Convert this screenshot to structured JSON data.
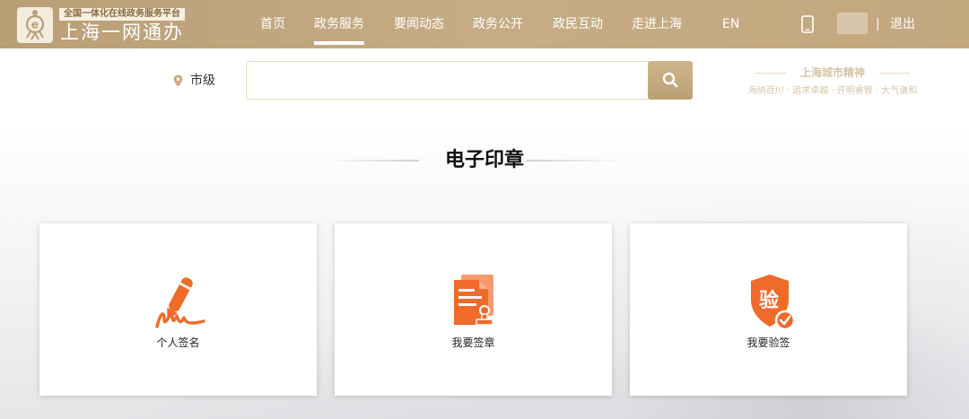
{
  "header": {
    "logo_badge": "全国一体化在线政务服务平台",
    "logo_title": "上海一网通办",
    "nav": [
      "首页",
      "政务服务",
      "要闻动态",
      "政务公开",
      "政民互动",
      "走进上海",
      "EN"
    ],
    "active_nav": "政务服务",
    "logout": "退出",
    "user_divider": "|"
  },
  "search": {
    "region": "市级",
    "placeholder": "",
    "value": ""
  },
  "spirit": {
    "title": "上海城市精神",
    "subtitle": "海纳百川 · 追求卓越 · 开明睿智 · 大气谦和"
  },
  "section": {
    "title": "电子印章"
  },
  "cards": [
    {
      "label": "个人签名",
      "icon": "signature-pen-icon"
    },
    {
      "label": "我要签章",
      "icon": "document-stamp-icon"
    },
    {
      "label": "我要验签",
      "icon": "verify-shield-icon",
      "icon_text": "验"
    }
  ],
  "colors": {
    "header_gold": "#c2a77f",
    "accent_orange": "#f06a2a",
    "search_button": "#c4a87e"
  }
}
